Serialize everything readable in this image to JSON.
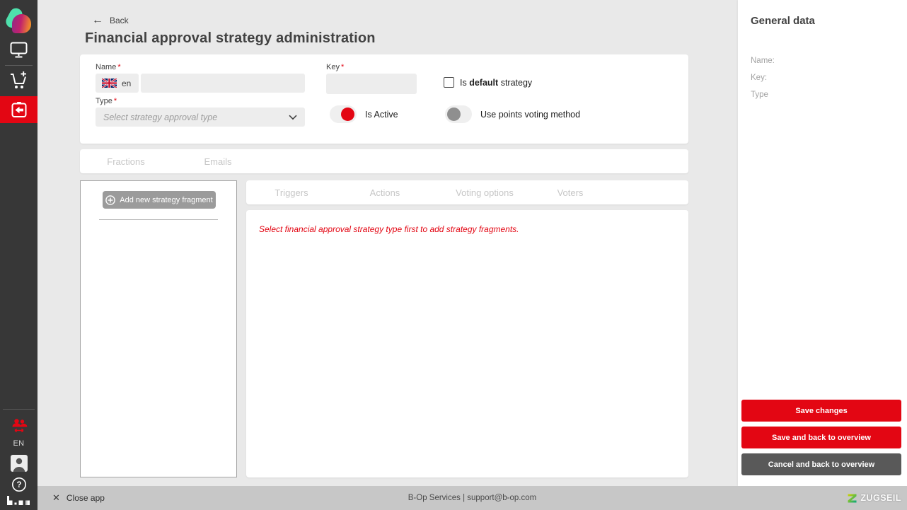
{
  "colors": {
    "accent_red": "#e30613",
    "sidebar_bg": "#373737",
    "main_bg": "#e9e9e9",
    "footer_bg": "#c7c7c7",
    "primary_button": "#e30613",
    "secondary_button": "#595959",
    "add_button_gray": "#9b9b9b",
    "disabled_tab_text": "#c6c6c6"
  },
  "sidebar": {
    "language": "EN"
  },
  "header": {
    "back_icon": "←",
    "back_label": "Back",
    "title": "Financial approval strategy administration"
  },
  "form": {
    "required_marker": "*",
    "name": {
      "label": "Name",
      "lang_code": "en",
      "value": ""
    },
    "key": {
      "label": "Key",
      "value": ""
    },
    "type": {
      "label": "Type",
      "placeholder": "Select strategy approval type"
    },
    "is_default": {
      "prefix": "Is",
      "bold": "default",
      "suffix": "strategy",
      "checked": false
    },
    "is_active": {
      "label": "Is Active",
      "on": true
    },
    "points_voting": {
      "label": "Use points voting method",
      "on": false
    }
  },
  "outer_tabs": [
    {
      "label": "Fractions",
      "disabled": true
    },
    {
      "label": "Emails",
      "disabled": true
    }
  ],
  "fragments_panel": {
    "add_button_label": "Add new strategy fragment"
  },
  "inner_tabs": [
    {
      "label": "Triggers",
      "disabled": true
    },
    {
      "label": "Actions",
      "disabled": true
    },
    {
      "label": "Voting options",
      "disabled": true
    },
    {
      "label": "Voters",
      "disabled": true
    }
  ],
  "fragment_content": {
    "notice": "Select financial approval strategy type first to add strategy fragments."
  },
  "general_data": {
    "title": "General data",
    "name_label": "Name:",
    "key_label": "Key:",
    "type_label": "Type",
    "name_value": "",
    "key_value": "",
    "type_value": "",
    "buttons": [
      {
        "label": "Save changes",
        "variant": "primary"
      },
      {
        "label": "Save and back to overview",
        "variant": "primary"
      },
      {
        "label": "Cancel and back to overview",
        "variant": "secondary"
      }
    ]
  },
  "footer": {
    "close_icon": "✕",
    "close_label": "Close app",
    "service_text": "B-Op Services | support@b-op.com",
    "brand": "ZUGSEIL"
  }
}
